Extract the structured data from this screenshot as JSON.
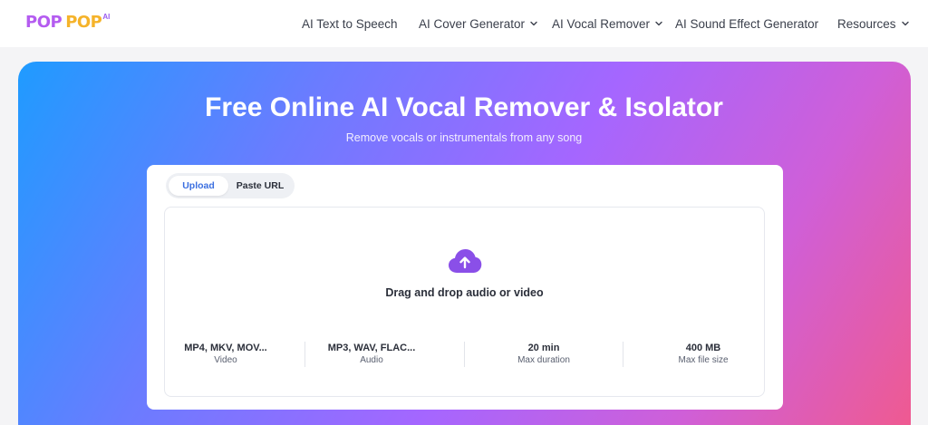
{
  "logo": {
    "word1": "POP",
    "word2": "POP",
    "suffix": "AI"
  },
  "nav": {
    "items": [
      {
        "label": "AI Text to Speech",
        "dropdown": false
      },
      {
        "label": "AI Cover Generator",
        "dropdown": true
      },
      {
        "label": "AI Vocal Remover",
        "dropdown": true
      },
      {
        "label": "AI Sound Effect Generator",
        "dropdown": false
      },
      {
        "label": "Resources",
        "dropdown": true
      }
    ]
  },
  "hero": {
    "title": "Free Online AI Vocal Remover & Isolator",
    "subtitle": "Remove vocals or instrumentals from any song"
  },
  "tabs": {
    "upload": "Upload",
    "paste_url": "Paste URL",
    "active": "upload"
  },
  "dropzone": {
    "icon": "cloud-upload-icon",
    "text": "Drag and drop audio or video"
  },
  "specs": [
    {
      "value": "MP4, MKV, MOV...",
      "label": "Video"
    },
    {
      "value": "MP3, WAV, FLAC...",
      "label": "Audio"
    },
    {
      "value": "20 min",
      "label": "Max duration"
    },
    {
      "value": "400 MB",
      "label": "Max file size"
    }
  ],
  "colors": {
    "accent": "#3b6fe0",
    "upload_icon": "#8a4fe8",
    "gradient_start": "#1f9bff",
    "gradient_end": "#f05a8e"
  }
}
